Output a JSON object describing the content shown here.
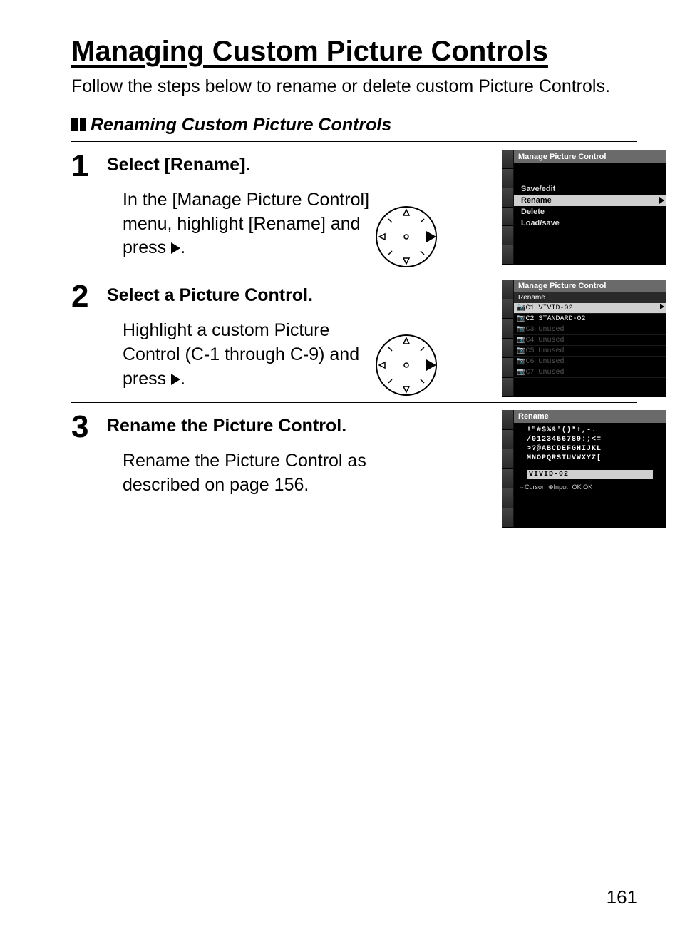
{
  "title": "Managing Custom Picture Controls",
  "intro": "Follow the steps below to rename or delete custom Picture Controls.",
  "section": "Renaming Custom Picture Controls",
  "steps": [
    {
      "num": "1",
      "title": "Select [Rename].",
      "text_a": "In the [Manage Picture Control] menu, highlight [Rename] and press ",
      "text_b": ".",
      "screen": {
        "header": "Manage Picture Control",
        "items": [
          "Save/edit",
          "Rename",
          "Delete",
          "Load/save"
        ],
        "hl_index": 1
      }
    },
    {
      "num": "2",
      "title": "Select a Picture Control.",
      "text_a": "Highlight a custom Picture Control (C-1 through C-9) and press ",
      "text_b": ".",
      "screen": {
        "header": "Manage Picture Control",
        "sub": "Rename",
        "list": [
          {
            "label": "C1 VIVID-02",
            "active": true,
            "hl": true
          },
          {
            "label": "C2 STANDARD-02",
            "active": true
          },
          {
            "label": "C3 Unused"
          },
          {
            "label": "C4 Unused"
          },
          {
            "label": "C5 Unused"
          },
          {
            "label": "C6 Unused"
          },
          {
            "label": "C7 Unused"
          }
        ]
      }
    },
    {
      "num": "3",
      "title": "Rename the Picture Control.",
      "text_a": "Rename the Picture Control as described on page 156.",
      "screen": {
        "header": "Rename",
        "chars1": "!\"#$%&'()*+,-.",
        "chars2": "/0123456789:;<=",
        "chars3": ">?@ABCDEFGHIJKL",
        "chars4": "MNOPQRSTUVWXYZ[",
        "input": "VIVID-02",
        "footer": [
          "⇔Cursor",
          "⊕Input",
          "OK OK"
        ]
      }
    }
  ],
  "page_number": "161"
}
